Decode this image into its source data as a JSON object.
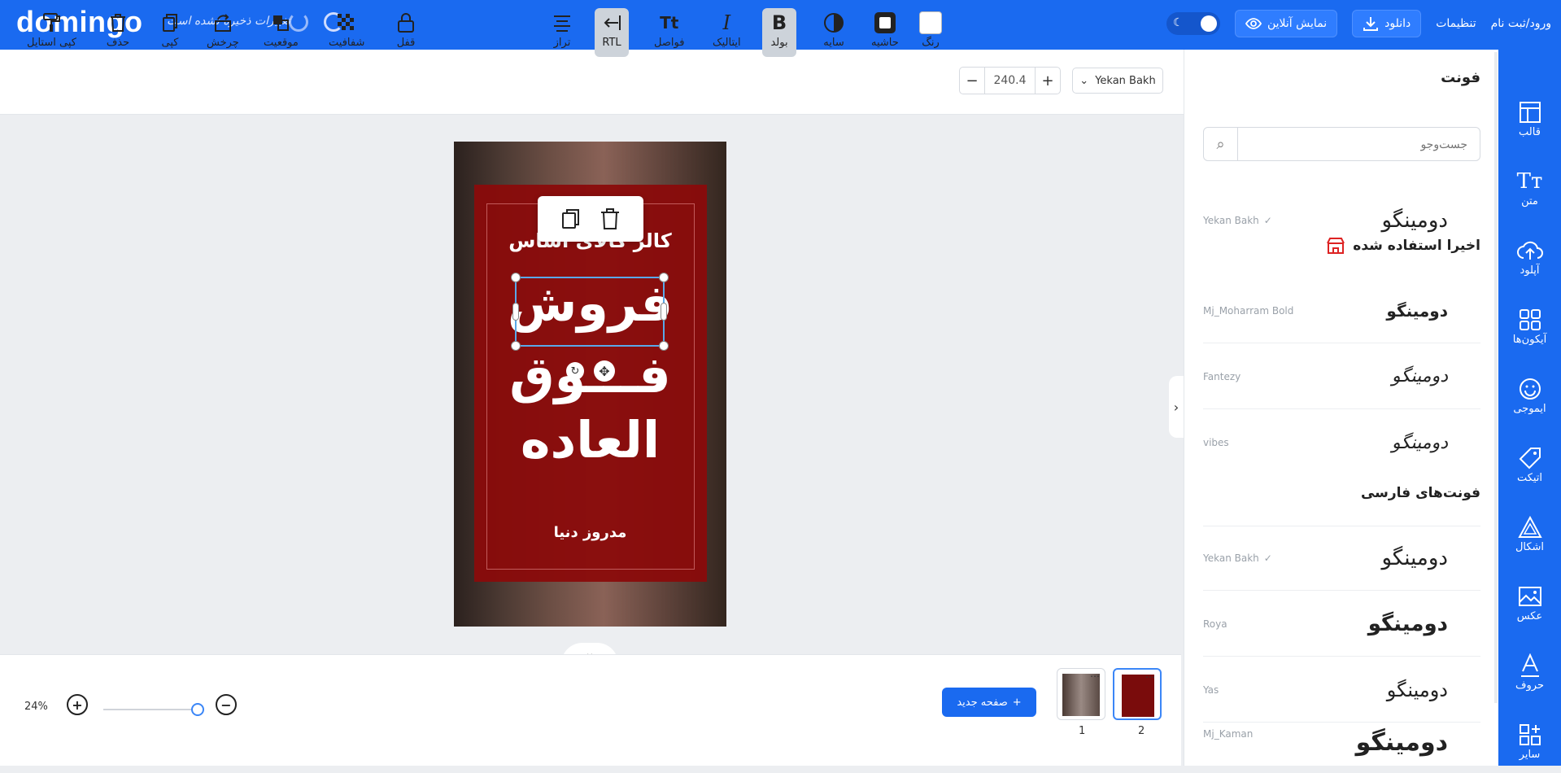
{
  "topbar": {
    "logo": "domingo",
    "save_status": "تغییرات ذخیره نشده است",
    "login": "ورود/ثبت نام",
    "settings": "تنظیمات",
    "download": "دانلود",
    "preview": "نمایش آنلاین"
  },
  "toolbar": {
    "font": "Yekan Bakh",
    "font_size": "240.4",
    "color": "رنگ",
    "border": "حاشیه",
    "shadow": "سایه",
    "bold": "بولد",
    "italic": "ایتالیک",
    "spacing": "فواصل",
    "rtl": "RTL",
    "align": "تراز",
    "lock": "قفل",
    "opacity": "شفافیت",
    "position": "موقعیت",
    "rotate": "چرخش",
    "copy": "کپی",
    "delete": "حذف",
    "copy_style": "کپی استایل"
  },
  "poster": {
    "ghost_title": "کالر کالای اساس",
    "line1": "فروش",
    "line2": "فـــوق",
    "line3": "العاده",
    "footer": "مدروز دنیا"
  },
  "bottom": {
    "zoom": "24%",
    "new_page": "صفحه جدید",
    "pages": [
      "1",
      "2"
    ]
  },
  "panel": {
    "title": "فونت",
    "search_placeholder": "جست‌وجو",
    "current_font": {
      "name": "Yekan Bakh",
      "sample": "دومینگو"
    },
    "recent_title": "اخیرا استفاده شده",
    "recent": [
      {
        "name": "Mj_Moharram Bold",
        "sample": "دومینگو"
      },
      {
        "name": "Fantezy",
        "sample": "دومینگو"
      },
      {
        "name": "vibes",
        "sample": "دومینگو"
      }
    ],
    "persian_title": "فونت‌های فارسی",
    "persian": [
      {
        "name": "Yekan Bakh",
        "sample": "دومینگو"
      },
      {
        "name": "Roya",
        "sample": "دومینگو"
      },
      {
        "name": "Yas",
        "sample": "دومینگو"
      },
      {
        "name": "Mj_Kaman",
        "sample": "دومینگو"
      }
    ]
  },
  "sidebar": {
    "items": [
      {
        "label": "قالب",
        "icon": "template-icon"
      },
      {
        "label": "متن",
        "icon": "text-icon"
      },
      {
        "label": "آپلود",
        "icon": "upload-icon"
      },
      {
        "label": "آیکون‌ها",
        "icon": "icons-icon"
      },
      {
        "label": "ایموجی",
        "icon": "emoji-icon"
      },
      {
        "label": "اتیکت",
        "icon": "tag-icon"
      },
      {
        "label": "اشکال",
        "icon": "shapes-icon"
      },
      {
        "label": "عکس",
        "icon": "image-icon"
      },
      {
        "label": "حروف",
        "icon": "letters-icon"
      },
      {
        "label": "سایر",
        "icon": "more-icon"
      }
    ]
  },
  "colors": {
    "accent": "#1a6af0",
    "poster_red": "#8a0b0b"
  }
}
